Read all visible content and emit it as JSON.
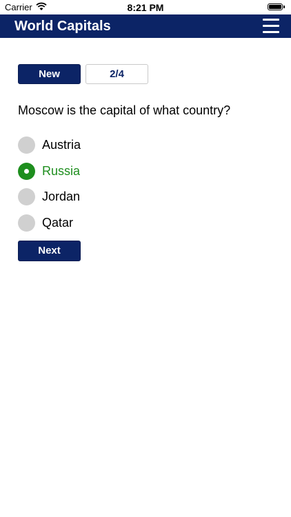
{
  "status_bar": {
    "carrier": "Carrier",
    "time": "8:21 PM"
  },
  "nav": {
    "title": "World Capitals",
    "menu_icon": "hamburger-menu-icon"
  },
  "controls": {
    "new_label": "New",
    "progress": "2/4"
  },
  "quiz": {
    "question": "Moscow is the capital of what country?",
    "options": [
      {
        "label": "Austria",
        "selected": false
      },
      {
        "label": "Russia",
        "selected": true
      },
      {
        "label": "Jordan",
        "selected": false
      },
      {
        "label": "Qatar",
        "selected": false
      }
    ],
    "next_label": "Next"
  },
  "colors": {
    "brand_navy": "#0c2466",
    "selected_green": "#1e8e1e",
    "unselected_gray": "#d0d0d0"
  }
}
